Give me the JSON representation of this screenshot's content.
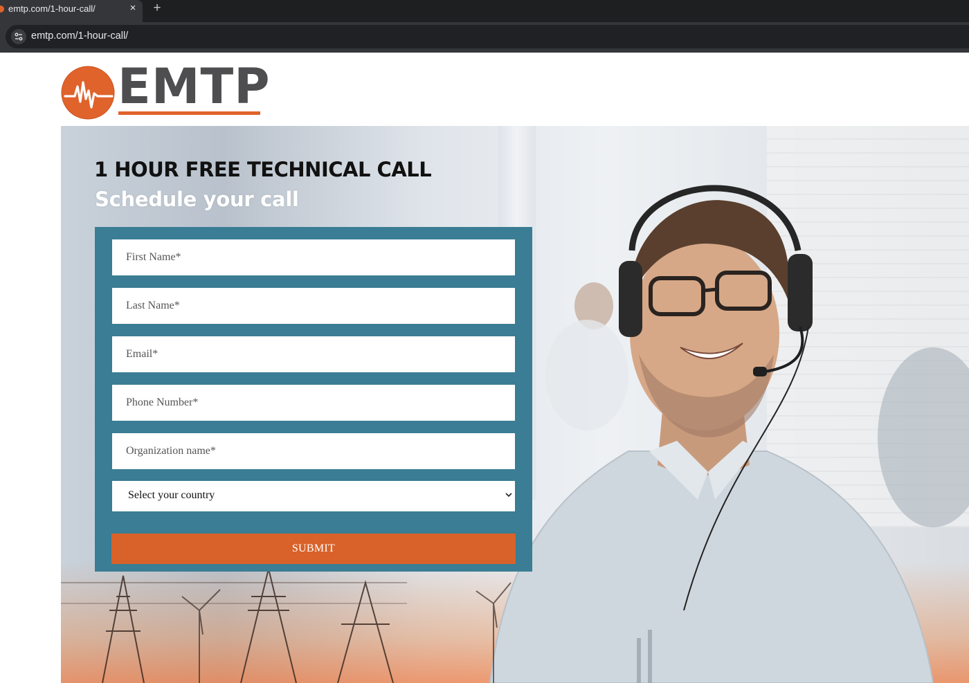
{
  "browser": {
    "tab_title": "emtp.com/1-hour-call/",
    "tab_close": "×",
    "new_tab": "+",
    "url": "emtp.com/1-hour-call/"
  },
  "logo": {
    "wordmark": "EMTP",
    "brand_color": "#e0632b"
  },
  "hero": {
    "headline": "1 HOUR FREE TECHNICAL CALL",
    "subheadline": "Schedule your call"
  },
  "form": {
    "panel_color": "#3a7d94",
    "fields": {
      "first_name": {
        "placeholder": "First Name*",
        "value": ""
      },
      "last_name": {
        "placeholder": "Last Name*",
        "value": ""
      },
      "email": {
        "placeholder": "Email*",
        "value": ""
      },
      "phone": {
        "placeholder": "Phone Number*",
        "value": ""
      },
      "organization": {
        "placeholder": "Organization name*",
        "value": ""
      }
    },
    "country_select": {
      "selected": "Select your country",
      "icon": "chevron-down-icon"
    },
    "submit_label": "SUBMIT",
    "submit_color": "#d9622a"
  }
}
